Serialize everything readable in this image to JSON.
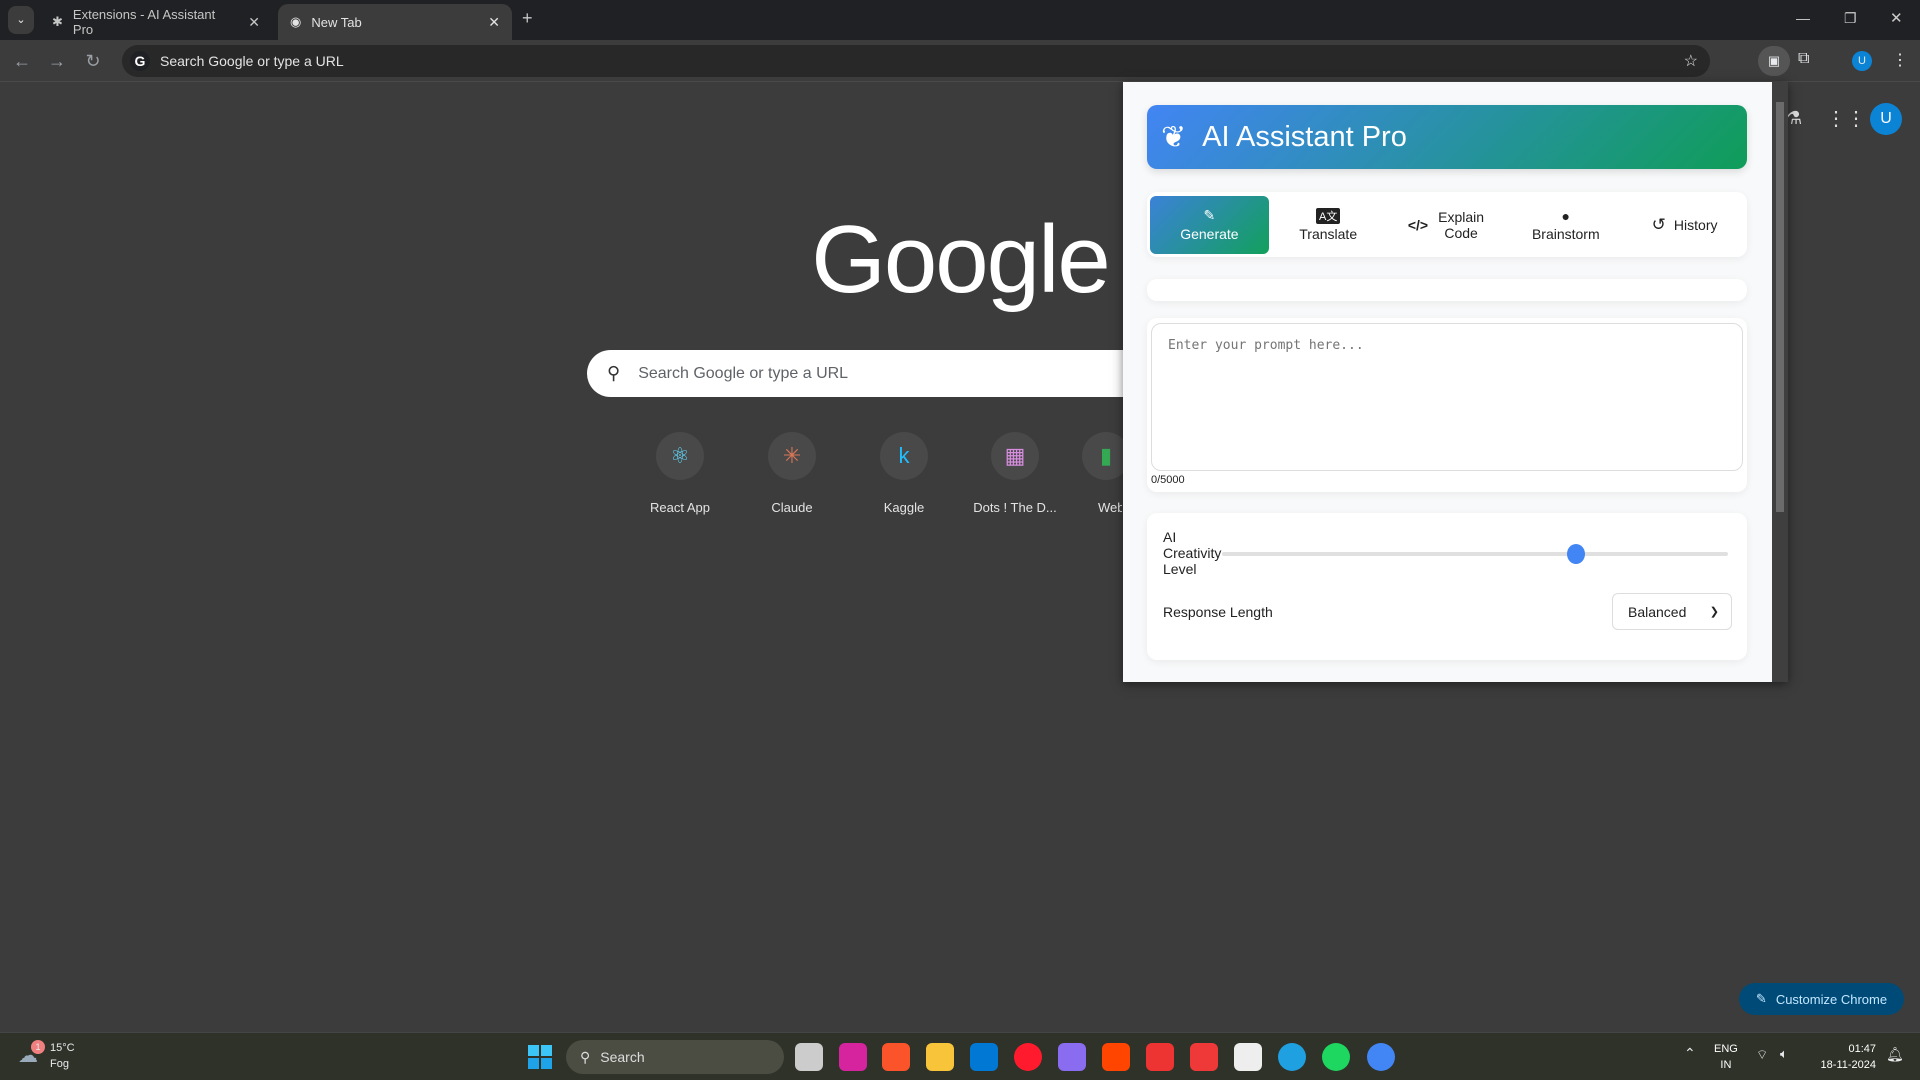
{
  "browser": {
    "tabs": [
      {
        "title": "Extensions - AI Assistant Pro",
        "icon": "puzzle-icon"
      },
      {
        "title": "New Tab",
        "icon": "chrome-icon",
        "active": true
      }
    ],
    "omnibox_placeholder": "Search Google or type a URL"
  },
  "newtab": {
    "logo": "Google",
    "search_placeholder": "Search Google or type a URL",
    "shortcuts": [
      {
        "label": "React App",
        "icon": "⚛",
        "color": "#61dafb"
      },
      {
        "label": "Claude",
        "icon": "✳",
        "color": "#d97757"
      },
      {
        "label": "Kaggle",
        "icon": "k",
        "color": "#20beff"
      },
      {
        "label": "Dots ! The D...",
        "icon": "▦",
        "color": "#d88ee0"
      },
      {
        "label": "Web",
        "icon": "▮",
        "color": "#34a853"
      }
    ],
    "customize_label": "Customize Chrome",
    "avatar_letter": "U"
  },
  "extension": {
    "title": "AI Assistant Pro",
    "tabs": [
      {
        "label": "Generate",
        "icon": "magic-wand-icon",
        "glyph": "✨"
      },
      {
        "label": "Translate",
        "icon": "translate-icon",
        "glyph": "🅰"
      },
      {
        "label": "Explain Code",
        "icon": "code-icon",
        "glyph": "</>"
      },
      {
        "label": "Brainstorm",
        "icon": "lightbulb-icon",
        "glyph": "💡"
      },
      {
        "label": "History",
        "icon": "history-icon",
        "glyph": "↺"
      }
    ],
    "active_tab": "Generate",
    "prompt_placeholder": "Enter your prompt here...",
    "char_count": "0/5000",
    "creativity_label": "AI Creativity Level",
    "creativity_value_percent": 70,
    "response_length_label": "Response Length",
    "response_length_value": "Balanced",
    "accent": "#4285f4",
    "gradient": [
      "#4285f4",
      "#0f9d58"
    ]
  },
  "taskbar": {
    "weather_temp": "15°C",
    "weather_desc": "Fog",
    "weather_badge": "1",
    "search_label": "Search",
    "lang": "ENG",
    "region": "IN",
    "time": "01:47",
    "date": "18-11-2024",
    "apps": [
      {
        "name": "task-view",
        "color": "#ccc"
      },
      {
        "name": "instagram",
        "color": "#d6249f"
      },
      {
        "name": "brave",
        "color": "#fb542b"
      },
      {
        "name": "file-explorer",
        "color": "#f8c43a"
      },
      {
        "name": "vscode",
        "color": "#0078d4"
      },
      {
        "name": "opera",
        "color": "#ff1b2d"
      },
      {
        "name": "copilot",
        "color": "#8a6cf0"
      },
      {
        "name": "reddit",
        "color": "#ff4500"
      },
      {
        "name": "popcorn",
        "color": "#e33"
      },
      {
        "name": "vivaldi",
        "color": "#ef3939"
      },
      {
        "name": "ms-store",
        "color": "#eee"
      },
      {
        "name": "edge",
        "color": "#1fa0e0"
      },
      {
        "name": "spotify",
        "color": "#1ed760"
      },
      {
        "name": "chrome",
        "color": "#4285f4"
      }
    ]
  }
}
